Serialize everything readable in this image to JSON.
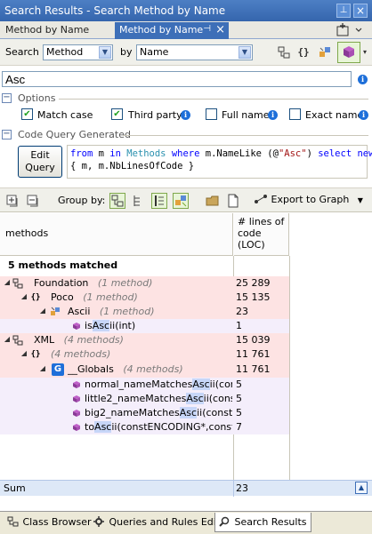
{
  "window": {
    "title": "Search Results - Search Method by Name"
  },
  "tabs": [
    {
      "label": "Method by Name"
    },
    {
      "label": "Method by Name"
    }
  ],
  "search": {
    "search_label": "Search",
    "search_type": "Method",
    "by_label": "by",
    "by_type": "Name",
    "query": "Asc"
  },
  "options": {
    "section_label": "Options",
    "match_case": "Match case",
    "third_party": "Third party",
    "full_name": "Full name",
    "exact_name": "Exact name"
  },
  "code_query": {
    "section_label": "Code Query Generated",
    "edit_button": [
      "Edit",
      "Query"
    ],
    "line1": {
      "from": "from",
      "m1": " m ",
      "in": "in",
      "methods": " Methods ",
      "where": "where",
      "expr": " m.NameLike (@",
      "str": "\"Asc\"",
      "close": ") ",
      "select": "select",
      "new": " new"
    },
    "line2": "{ m, m.NbLinesOfCode }"
  },
  "toolbar": {
    "group_by_label": "Group by:",
    "export_label": "Export to Graph"
  },
  "grid": {
    "col_methods": "methods",
    "col_loc": [
      "# lines of",
      "code",
      "(LOC)"
    ],
    "matched_label": "5 methods matched",
    "rows": [
      {
        "name": "Foundation",
        "count": "(1 method)",
        "loc": "25 289"
      },
      {
        "name": "Poco",
        "count": "(1 method)",
        "loc": "15 135"
      },
      {
        "name": "Ascii",
        "count": "(1 method)",
        "loc": "23"
      },
      {
        "pre": "is",
        "hl": "Asc",
        "post": "ii(int)",
        "loc": "1"
      },
      {
        "name": "XML",
        "count": "(4 methods)",
        "loc": "15 039"
      },
      {
        "name": "",
        "count": "(4 methods)",
        "loc": "11 761"
      },
      {
        "name": "_Globals",
        "count": "(4 methods)",
        "loc": "11 761"
      },
      {
        "pre": "normal_nameMatches",
        "hl": "Asc",
        "post": "ii(const",
        "loc": "5"
      },
      {
        "pre": "little2_nameMatches",
        "hl": "Asc",
        "post": "ii(constE",
        "loc": "5"
      },
      {
        "pre": "big2_nameMatches",
        "hl": "Asc",
        "post": "ii(constEN",
        "loc": "5"
      },
      {
        "pre": "to",
        "hl": "Asc",
        "post": "ii(constENCODING*,constc",
        "loc": "7"
      }
    ],
    "sum_label": "Sum",
    "sum_value": "23"
  },
  "bottom_tabs": [
    {
      "label": "Class Browser"
    },
    {
      "label": "Queries and Rules Edit"
    },
    {
      "label": "Search Results"
    }
  ],
  "colors": {
    "title_bar": "#3d6fb8",
    "pink_row": "#fde3e3",
    "highlight": "#c7d6f8",
    "sum_row": "#dde8f7"
  }
}
